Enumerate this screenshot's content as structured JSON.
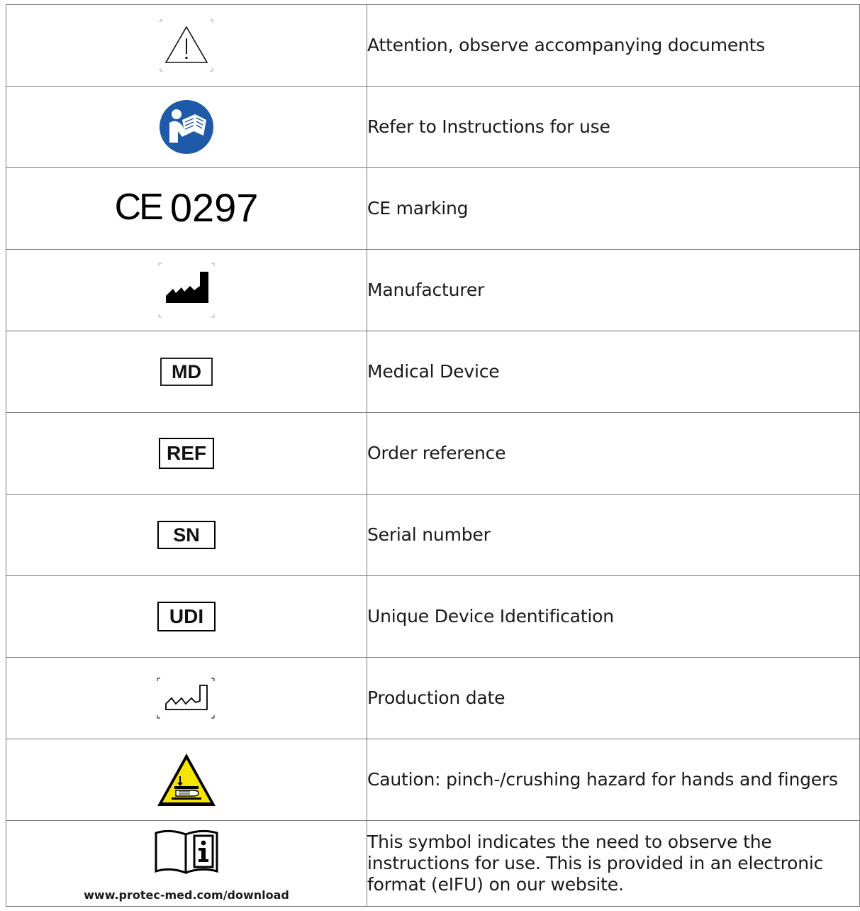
{
  "rows": [
    {
      "symbol": "warning-triangle-icon",
      "description": "Attention, observe accompanying documents"
    },
    {
      "symbol": "instructions-reader-icon",
      "description": "Refer to Instructions for use"
    },
    {
      "symbol": "ce-mark",
      "ce_letters": "CE",
      "ce_number": "0297",
      "description": "CE marking"
    },
    {
      "symbol": "manufacturer-factory-icon",
      "description": "Manufacturer"
    },
    {
      "symbol": "md-box",
      "label": "MD",
      "description": "Medical Device"
    },
    {
      "symbol": "ref-box",
      "label": "REF",
      "description": "Order reference"
    },
    {
      "symbol": "sn-box",
      "label": "SN",
      "description": "Serial number"
    },
    {
      "symbol": "udi-box",
      "label": "UDI",
      "description": "Unique Device Identification"
    },
    {
      "symbol": "production-date-factory-icon",
      "description": "Production date"
    },
    {
      "symbol": "hand-crush-warning-icon",
      "description": "Caution: pinch-/crushing hazard for hands and fingers"
    },
    {
      "symbol": "eifu-book-info-icon",
      "url": "www.protec-med.com/download",
      "description": "This symbol indicates the need to observe the instructions for use. This is provided in an electronic format (eIFU) on our website."
    }
  ],
  "colors": {
    "border": "#7a7a7a",
    "ifu_blue": "#1e5aa8",
    "hazard_yellow": "#f5e400"
  }
}
